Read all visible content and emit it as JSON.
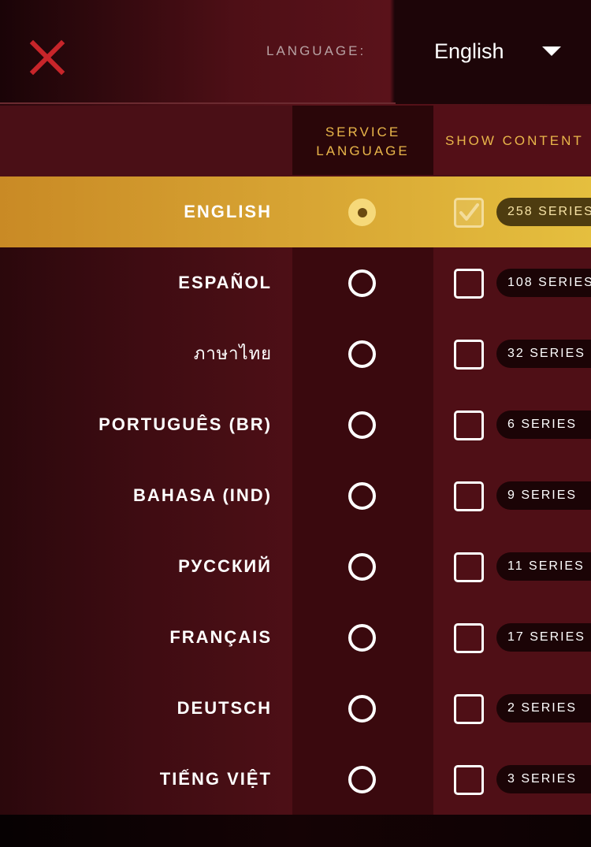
{
  "header": {
    "language_label": "LANGUAGE:",
    "selected_language": "English"
  },
  "columns": {
    "service_language_line1": "SERVICE",
    "service_language_line2": "LANGUAGE",
    "show_content": "SHOW CONTENT"
  },
  "languages": [
    {
      "name": "ENGLISH",
      "series": "258 SERIES",
      "service_selected": true,
      "show_checked": true
    },
    {
      "name": "ESPAÑOL",
      "series": "108 SERIES",
      "service_selected": false,
      "show_checked": false
    },
    {
      "name": "ภาษาไทย",
      "series": "32 SERIES",
      "service_selected": false,
      "show_checked": false
    },
    {
      "name": "PORTUGUÊS (BR)",
      "series": "6 SERIES",
      "service_selected": false,
      "show_checked": false
    },
    {
      "name": "BAHASA (IND)",
      "series": "9 SERIES",
      "service_selected": false,
      "show_checked": false
    },
    {
      "name": "РУССКИЙ",
      "series": "11 SERIES",
      "service_selected": false,
      "show_checked": false
    },
    {
      "name": "FRANÇAIS",
      "series": "17 SERIES",
      "service_selected": false,
      "show_checked": false
    },
    {
      "name": "DEUTSCH",
      "series": "2 SERIES",
      "service_selected": false,
      "show_checked": false
    },
    {
      "name": "TIẾNG VIỆT",
      "series": "3 SERIES",
      "service_selected": false,
      "show_checked": false
    }
  ],
  "colors": {
    "accent": "#e9b64a",
    "close_icon": "#c8252a",
    "selected_row": "#d7a433",
    "background": "#4a0e15"
  },
  "icons": {
    "close": "close-icon",
    "dropdown": "chevron-down-icon",
    "radio": "radio-icon",
    "check": "checkmark-icon"
  }
}
